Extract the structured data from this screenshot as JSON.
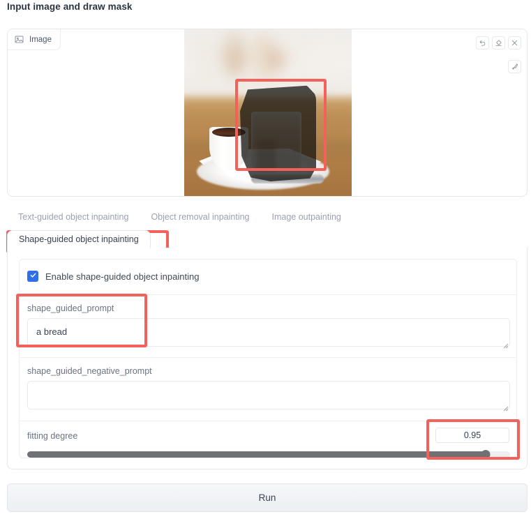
{
  "page": {
    "title": "Input image and draw mask"
  },
  "image_panel": {
    "tab_label": "Image",
    "tab_icon": "picture-icon",
    "toolbar": [
      {
        "name": "undo-icon",
        "title": "Undo"
      },
      {
        "name": "eraser-icon",
        "title": "Erase"
      },
      {
        "name": "close-icon",
        "title": "Clear"
      }
    ],
    "brush_tool": {
      "name": "brush-icon",
      "title": "Brush"
    },
    "photo_description": "Blurred cafe photo: white espresso cup and a glass of water on a metal tray with a napkin, dark mask painted over the glass",
    "mask_color": "#181614"
  },
  "tabs": {
    "row1": [
      {
        "label": "Text-guided object inpainting",
        "active": false
      },
      {
        "label": "Object removal inpainting",
        "active": false
      },
      {
        "label": "Image outpainting",
        "active": false
      }
    ],
    "row2": [
      {
        "label": "Shape-guided object inpainting",
        "active": true
      }
    ]
  },
  "options": {
    "enable_checkbox": {
      "label": "Enable shape-guided object inpainting",
      "checked": true,
      "color": "#2f6fea"
    },
    "prompt": {
      "label": "shape_guided_prompt",
      "value": "a bread",
      "placeholder": ""
    },
    "negative_prompt": {
      "label": "shape_guided_negative_prompt",
      "value": "",
      "placeholder": ""
    },
    "fitting_degree": {
      "label": "fitting degree",
      "value": "0.95",
      "percent": 95,
      "min": 0,
      "max": 1
    }
  },
  "run": {
    "label": "Run"
  },
  "annotations": {
    "color": "#f4615a",
    "boxes": [
      "mask-region",
      "active-tab",
      "shape-guided-prompt",
      "fitting-degree-value"
    ]
  }
}
